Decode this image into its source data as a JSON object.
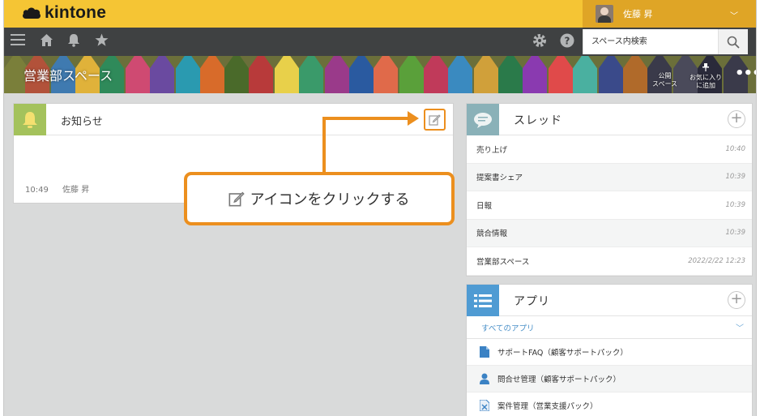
{
  "brand": {
    "name": "kintone"
  },
  "user": {
    "name": "佐藤 昇"
  },
  "search": {
    "placeholder": "スペース内検索"
  },
  "space": {
    "title": "営業部スペース",
    "actions": [
      {
        "label": "公開\nスペース"
      },
      {
        "label": "お気に入り\nに追加"
      }
    ]
  },
  "notice": {
    "title": "お知らせ",
    "time": "10:49",
    "author": "佐藤 昇"
  },
  "callout": {
    "text": "アイコンをクリックする"
  },
  "threads": {
    "title": "スレッド",
    "items": [
      {
        "name": "売り上げ",
        "time": "10:40"
      },
      {
        "name": "提案書シェア",
        "time": "10:39"
      },
      {
        "name": "日報",
        "time": "10:39"
      },
      {
        "name": "競合情報",
        "time": "10:39"
      },
      {
        "name": "営業部スペース",
        "time": "2022/2/22 12:23"
      }
    ]
  },
  "apps": {
    "title": "アプリ",
    "filter": "すべてのアプリ",
    "items": [
      {
        "name": "サポートFAQ（顧客サポートパック）",
        "icon": "document-icon"
      },
      {
        "name": "問合せ管理（顧客サポートパック）",
        "icon": "person-icon"
      },
      {
        "name": "案件管理（営業支援パック）",
        "icon": "excel-file-icon"
      }
    ]
  },
  "colors": {
    "header": "#f5c534",
    "toolbar": "#3f4142",
    "accent": "#ec8f1e",
    "notice_icon_bg": "#a4c25c",
    "thread_icon_bg": "#8ab1b8",
    "app_icon_bg": "#4f9bd3"
  }
}
